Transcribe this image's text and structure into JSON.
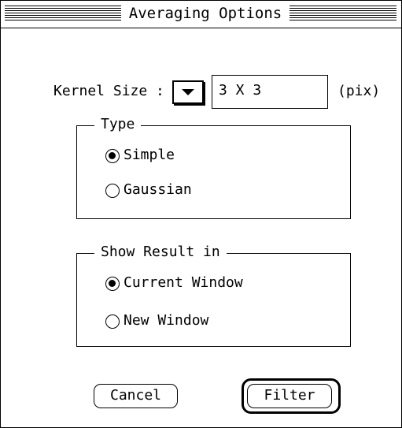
{
  "window": {
    "title": "Averaging Options"
  },
  "kernel": {
    "label": "Kernel Size :",
    "value": "3 X 3",
    "unit": "(pix)"
  },
  "type_group": {
    "legend": "Type",
    "options": [
      {
        "label": "Simple",
        "checked": true
      },
      {
        "label": "Gaussian",
        "checked": false
      }
    ]
  },
  "result_group": {
    "legend": "Show Result in",
    "options": [
      {
        "label": "Current Window",
        "checked": true
      },
      {
        "label": "New Window",
        "checked": false
      }
    ]
  },
  "buttons": {
    "cancel": "Cancel",
    "filter": "Filter"
  }
}
